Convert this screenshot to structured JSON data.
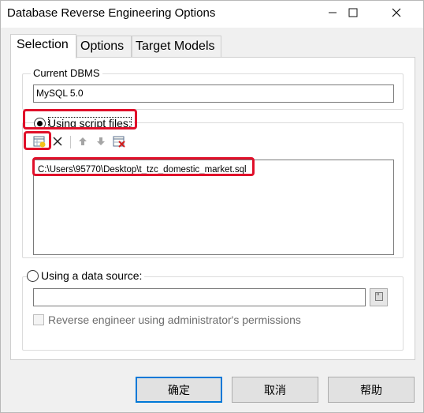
{
  "window": {
    "title": "Database Reverse Engineering Options"
  },
  "titlebar": {
    "minimize_icon": "minimize-icon",
    "maximize_icon": "maximize-icon",
    "close_icon": "close-icon"
  },
  "tabs": [
    {
      "label": "Selection",
      "active": true
    },
    {
      "label": "Options",
      "active": false
    },
    {
      "label": "Target Models",
      "active": false
    }
  ],
  "dbms": {
    "legend": "Current DBMS",
    "value": "MySQL 5.0"
  },
  "script": {
    "radio_label": "Using script files:",
    "selected": true,
    "toolbar": [
      "add-file-icon",
      "delete-icon",
      "move-up-icon",
      "move-down-icon",
      "clear-list-icon"
    ],
    "files": [
      "C:\\Users\\95770\\Desktop\\t_tzc_domestic_market.sql"
    ]
  },
  "datasource": {
    "radio_label": "Using a data source:",
    "selected": false,
    "value": "",
    "browse_icon": "datasource-browse-icon",
    "admin_checkbox_label": "Reverse engineer using administrator's permissions",
    "admin_checked": false
  },
  "buttons": {
    "ok": "确定",
    "cancel": "取消",
    "help": "帮助"
  },
  "colors": {
    "highlight": "#e0102a",
    "default_button_border": "#0078d7"
  }
}
